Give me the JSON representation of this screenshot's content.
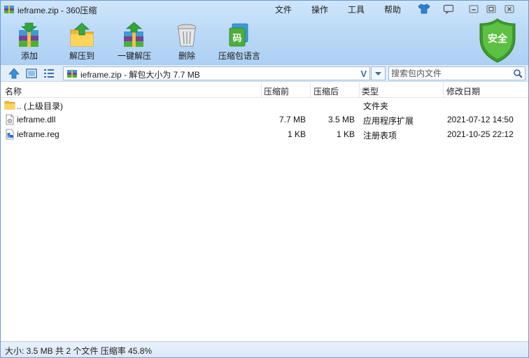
{
  "window": {
    "title": "ieframe.zip - 360压缩",
    "menus": [
      "文件",
      "操作",
      "工具",
      "帮助"
    ]
  },
  "toolbar": {
    "add": "添加",
    "extract_to": "解压到",
    "one_click_extract": "一键解压",
    "delete": "删除",
    "lang_pack": "压缩包语言",
    "lang_pack_icon_char": "码"
  },
  "security_badge": "安全",
  "address": {
    "path": "ieframe.zip - 解包大小为 7.7 MB",
    "validate_icon": "V"
  },
  "search": {
    "placeholder": "搜索包内文件"
  },
  "columns": {
    "name": "名称",
    "compressed_before": "压缩前",
    "compressed_after": "压缩后",
    "type": "类型",
    "modified": "修改日期"
  },
  "files": [
    {
      "name": ".. (上级目录)",
      "before": "",
      "after": "",
      "type": "文件夹",
      "modified": "",
      "icon": "folder-icon"
    },
    {
      "name": "ieframe.dll",
      "before": "7.7 MB",
      "after": "3.5 MB",
      "type": "应用程序扩展",
      "modified": "2021-07-12 14:50",
      "icon": "dll-file-icon"
    },
    {
      "name": "ieframe.reg",
      "before": "1 KB",
      "after": "1 KB",
      "type": "注册表项",
      "modified": "2021-10-25 22:12",
      "icon": "reg-file-icon"
    }
  ],
  "status": {
    "text": "大小: 3.5 MB 共 2 个文件 压缩率 45.8%"
  },
  "colors": {
    "header_top": "#cfe6fb",
    "header_bottom": "#acd0f4",
    "shield_green": "#4caf3a",
    "accent_blue": "#3a6ea5"
  }
}
